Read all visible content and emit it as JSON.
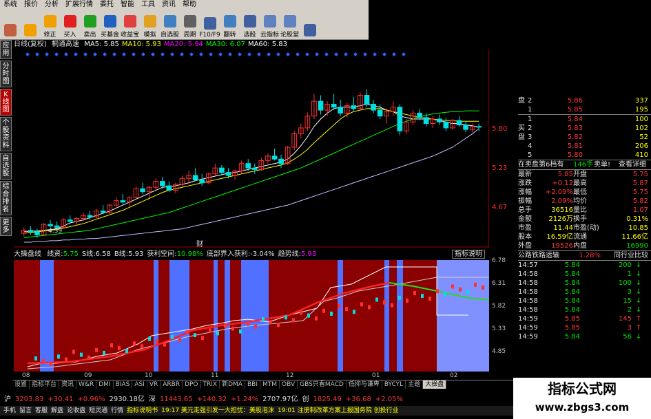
{
  "menu": [
    "系统",
    "报价",
    "分析",
    "扩展行情",
    "委托",
    "智能",
    "工具",
    "资讯",
    "帮助"
  ],
  "toolbar": [
    {
      "label": "",
      "icon": "grid-icon",
      "color": "#c06040"
    },
    {
      "label": "",
      "icon": "back-arrow-icon",
      "color": "#f0a000"
    },
    {
      "label": "修正",
      "icon": "up-down-arrow-icon",
      "color": "#f0a000"
    },
    {
      "label": "买入",
      "icon": "buy-icon",
      "color": "#e02020"
    },
    {
      "label": "卖出",
      "icon": "sell-icon",
      "color": "#20a020"
    },
    {
      "label": "买基金",
      "icon": "fund-icon",
      "color": "#2060c0"
    },
    {
      "label": "收益宝",
      "icon": "treasure-icon",
      "color": "#e04040"
    },
    {
      "label": "模拟",
      "icon": "simulate-icon",
      "color": "#e0a020"
    },
    {
      "label": "自选股",
      "icon": "star-list-icon",
      "color": "#4080c0"
    },
    {
      "label": "周期",
      "icon": "clock-icon",
      "color": "#606060"
    },
    {
      "label": "F10/F9",
      "icon": "f10-icon",
      "color": "#4060a0"
    },
    {
      "label": "翻转",
      "icon": "flip-icon",
      "color": "#4080c0"
    },
    {
      "label": "选股",
      "icon": "stock-pick-icon",
      "color": "#4060a0"
    },
    {
      "label": "云指标",
      "icon": "cloud-icon",
      "color": "#6080c0"
    },
    {
      "label": "论股堂",
      "icon": "forum-icon",
      "color": "#6080c0"
    },
    {
      "label": "",
      "icon": "info-icon",
      "color": "#4060a0"
    }
  ],
  "sidebar": [
    "应用",
    "分时图",
    "K线图",
    "个股资料",
    "自选股",
    "综合排名",
    "更多"
  ],
  "chart_main": {
    "title": "日线(复权)",
    "stock": "桐通高速",
    "ma": [
      {
        "name": "MA5",
        "value": "5.85",
        "color": "#ffffff"
      },
      {
        "name": "MA10",
        "value": "5.93",
        "color": "#ffff00"
      },
      {
        "name": "MA20",
        "value": "5.94",
        "color": "#ff00ff"
      },
      {
        "name": "MA30",
        "value": "6.07",
        "color": "#00ff00"
      },
      {
        "name": "MA60",
        "value": "5.83",
        "color": "#ffffff"
      }
    ],
    "ylabels": [
      "5.80",
      "5.23",
      "4.67"
    ],
    "annot": "4.39",
    "mark": "财"
  },
  "chart_data": {
    "type": "candlestick",
    "ylim": [
      4.3,
      6.6
    ],
    "candles": [
      [
        4.42,
        4.5,
        4.38,
        4.46
      ],
      [
        4.46,
        4.52,
        4.4,
        4.44
      ],
      [
        4.44,
        4.48,
        4.36,
        4.4
      ],
      [
        4.4,
        4.56,
        4.39,
        4.54
      ],
      [
        4.54,
        4.6,
        4.5,
        4.52
      ],
      [
        4.52,
        4.58,
        4.46,
        4.5
      ],
      [
        4.5,
        4.62,
        4.48,
        4.6
      ],
      [
        4.6,
        4.66,
        4.55,
        4.58
      ],
      [
        4.58,
        4.64,
        4.52,
        4.62
      ],
      [
        4.62,
        4.7,
        4.58,
        4.66
      ],
      [
        4.66,
        4.72,
        4.6,
        4.64
      ],
      [
        4.64,
        4.75,
        4.62,
        4.72
      ],
      [
        4.72,
        4.8,
        4.68,
        4.7
      ],
      [
        4.7,
        4.82,
        4.68,
        4.8
      ],
      [
        4.8,
        4.9,
        4.76,
        4.86
      ],
      [
        4.86,
        4.95,
        4.82,
        4.84
      ],
      [
        4.84,
        4.92,
        4.78,
        4.9
      ],
      [
        4.9,
        5.05,
        4.88,
        5.02
      ],
      [
        5.02,
        5.1,
        4.95,
        4.98
      ],
      [
        4.98,
        5.06,
        4.9,
        5.04
      ],
      [
        5.04,
        5.16,
        5.0,
        5.12
      ],
      [
        5.12,
        5.18,
        5.02,
        5.06
      ],
      [
        5.06,
        5.12,
        4.98,
        5.0
      ],
      [
        5.0,
        5.1,
        4.96,
        5.08
      ],
      [
        5.08,
        5.2,
        5.04,
        5.16
      ],
      [
        5.16,
        5.26,
        5.1,
        5.2
      ],
      [
        5.2,
        5.3,
        5.12,
        5.14
      ],
      [
        5.14,
        5.22,
        5.06,
        5.1
      ],
      [
        5.1,
        5.24,
        5.08,
        5.22
      ],
      [
        5.22,
        5.36,
        5.18,
        5.3
      ],
      [
        5.3,
        5.34,
        5.2,
        5.24
      ],
      [
        5.24,
        5.3,
        5.16,
        5.2
      ],
      [
        5.2,
        5.28,
        5.14,
        5.26
      ],
      [
        5.26,
        5.4,
        5.22,
        5.36
      ],
      [
        5.36,
        5.42,
        5.26,
        5.3
      ],
      [
        5.3,
        5.36,
        5.22,
        5.28
      ],
      [
        5.28,
        5.44,
        5.26,
        5.4
      ],
      [
        5.4,
        5.5,
        5.36,
        5.46
      ],
      [
        5.46,
        5.56,
        5.4,
        5.42
      ],
      [
        5.42,
        5.48,
        5.3,
        5.36
      ],
      [
        5.36,
        5.6,
        5.34,
        5.58
      ],
      [
        5.58,
        5.8,
        5.54,
        5.76
      ],
      [
        5.76,
        5.9,
        5.7,
        5.84
      ],
      [
        5.84,
        6.05,
        5.8,
        6.0
      ],
      [
        6.0,
        6.3,
        5.96,
        6.2
      ],
      [
        6.2,
        6.28,
        6.02,
        6.08
      ],
      [
        6.08,
        6.2,
        6.0,
        6.16
      ],
      [
        6.16,
        6.3,
        6.08,
        6.12
      ],
      [
        6.12,
        6.22,
        6.0,
        6.04
      ],
      [
        6.04,
        6.18,
        5.98,
        6.14
      ],
      [
        6.14,
        6.26,
        6.06,
        6.1
      ],
      [
        6.1,
        6.32,
        6.08,
        6.28
      ],
      [
        6.28,
        6.36,
        6.12,
        6.16
      ],
      [
        6.16,
        6.22,
        6.04,
        6.08
      ],
      [
        6.08,
        6.16,
        5.96,
        6.0
      ],
      [
        6.0,
        6.1,
        5.9,
        6.06
      ],
      [
        6.06,
        6.2,
        6.0,
        6.12
      ],
      [
        6.12,
        6.16,
        5.74,
        5.8
      ],
      [
        5.8,
        5.96,
        5.76,
        5.92
      ],
      [
        5.92,
        6.08,
        5.88,
        6.04
      ],
      [
        6.04,
        6.1,
        5.94,
        5.98
      ],
      [
        5.98,
        6.04,
        5.86,
        5.9
      ],
      [
        5.9,
        6.0,
        5.84,
        5.96
      ],
      [
        5.96,
        6.02,
        5.88,
        5.92
      ],
      [
        5.92,
        5.98,
        5.8,
        5.84
      ],
      [
        5.84,
        5.96,
        5.82,
        5.94
      ],
      [
        5.94,
        6.0,
        5.86,
        5.88
      ],
      [
        5.88,
        5.92,
        5.78,
        5.82
      ],
      [
        5.82,
        5.9,
        5.78,
        5.86
      ],
      [
        5.86,
        5.9,
        5.8,
        5.85
      ]
    ],
    "ma_lines": [
      {
        "name": "MA5",
        "color": "#ffffff",
        "values": [
          4.44,
          4.45,
          4.45,
          4.46,
          4.47,
          4.48,
          4.52,
          4.56,
          4.58,
          4.6,
          4.63,
          4.66,
          4.69,
          4.72,
          4.76,
          4.8,
          4.84,
          4.88,
          4.92,
          4.96,
          5.0,
          5.04,
          5.05,
          5.06,
          5.08,
          5.1,
          5.13,
          5.15,
          5.17,
          5.19,
          5.21,
          5.23,
          5.24,
          5.26,
          5.28,
          5.3,
          5.32,
          5.34,
          5.36,
          5.38,
          5.42,
          5.5,
          5.6,
          5.72,
          5.86,
          5.96,
          6.04,
          6.1,
          6.12,
          6.12,
          6.12,
          6.14,
          6.16,
          6.14,
          6.12,
          6.08,
          6.06,
          6.0,
          5.98,
          5.96,
          5.96,
          5.96,
          5.96,
          5.94,
          5.92,
          5.9,
          5.9,
          5.88,
          5.87,
          5.85
        ]
      },
      {
        "name": "MA10",
        "color": "#ffff00",
        "values": [
          4.42,
          4.43,
          4.44,
          4.45,
          4.46,
          4.47,
          4.49,
          4.51,
          4.53,
          4.55,
          4.58,
          4.61,
          4.64,
          4.67,
          4.7,
          4.73,
          4.77,
          4.81,
          4.85,
          4.89,
          4.93,
          4.97,
          5.0,
          5.02,
          5.04,
          5.06,
          5.08,
          5.1,
          5.12,
          5.14,
          5.16,
          5.18,
          5.2,
          5.22,
          5.24,
          5.26,
          5.28,
          5.3,
          5.32,
          5.34,
          5.37,
          5.42,
          5.48,
          5.55,
          5.64,
          5.72,
          5.8,
          5.88,
          5.96,
          6.02,
          6.06,
          6.08,
          6.1,
          6.1,
          6.1,
          6.08,
          6.06,
          6.04,
          6.02,
          6.0,
          5.98,
          5.97,
          5.96,
          5.95,
          5.94,
          5.94,
          5.93,
          5.93,
          5.93,
          5.93
        ]
      },
      {
        "name": "MA30",
        "color": "#00ff00",
        "values": [
          4.36,
          4.37,
          4.38,
          4.39,
          4.4,
          4.41,
          4.42,
          4.43,
          4.44,
          4.45,
          4.46,
          4.48,
          4.5,
          4.52,
          4.54,
          4.56,
          4.58,
          4.6,
          4.62,
          4.64,
          4.66,
          4.68,
          4.7,
          4.73,
          4.76,
          4.79,
          4.82,
          4.85,
          4.88,
          4.91,
          4.94,
          4.97,
          5.0,
          5.03,
          5.06,
          5.09,
          5.12,
          5.15,
          5.18,
          5.21,
          5.24,
          5.27,
          5.3,
          5.34,
          5.38,
          5.42,
          5.46,
          5.5,
          5.54,
          5.58,
          5.62,
          5.66,
          5.7,
          5.74,
          5.78,
          5.82,
          5.86,
          5.9,
          5.93,
          5.96,
          5.99,
          6.01,
          6.03,
          6.04,
          6.05,
          6.06,
          6.06,
          6.07,
          6.07,
          6.07
        ]
      },
      {
        "name": "MA60",
        "color": "#c0c0ff",
        "values": [
          4.3,
          4.3,
          4.31,
          4.31,
          4.32,
          4.32,
          4.33,
          4.33,
          4.34,
          4.34,
          4.35,
          4.35,
          4.36,
          4.37,
          4.38,
          4.39,
          4.4,
          4.41,
          4.42,
          4.43,
          4.44,
          4.45,
          4.46,
          4.47,
          4.48,
          4.5,
          4.52,
          4.54,
          4.56,
          4.58,
          4.6,
          4.62,
          4.64,
          4.66,
          4.68,
          4.7,
          4.72,
          4.74,
          4.76,
          4.78,
          4.8,
          4.83,
          4.86,
          4.89,
          4.92,
          4.95,
          4.98,
          5.01,
          5.04,
          5.07,
          5.1,
          5.13,
          5.16,
          5.19,
          5.22,
          5.25,
          5.28,
          5.31,
          5.34,
          5.37,
          5.4,
          5.43,
          5.46,
          5.5,
          5.54,
          5.58,
          5.64,
          5.7,
          5.76,
          5.83
        ]
      }
    ]
  },
  "chart_sub": {
    "title": "大操盘线",
    "items": [
      {
        "label": "线资:",
        "value": "5.75",
        "color": "#00e000"
      },
      {
        "label": "S线:",
        "value": "6.58",
        "color": "#e0e0e0"
      },
      {
        "label": "B线:",
        "value": "5.93",
        "color": "#e0e0e0"
      },
      {
        "label": "获利空间:",
        "value": "10.98%",
        "color": "#00e000"
      },
      {
        "label": "底部界入获利:",
        "value": "-3.04%",
        "color": "#e0e0e0"
      },
      {
        "label": "趋势线:",
        "value": "5.93",
        "color": "#ff00ff"
      }
    ],
    "right_labels": [
      "指标说明"
    ],
    "ylabels": [
      "6.78",
      "6.31",
      "5.82",
      "5.33",
      "4.85"
    ]
  },
  "xaxis": [
    "08",
    "09",
    "10",
    "11",
    "12",
    "01",
    "02"
  ],
  "tabs": [
    "设置",
    "指标平台",
    "资讯",
    "W&R",
    "DMI",
    "BIAS",
    "ASI",
    "VR",
    "ARBR",
    "DPO",
    "TRIX",
    "新DMA",
    "BBI",
    "MTM",
    "OBV",
    "GBS只看MACD",
    "低抑与谦卑",
    "BYCYL",
    "主题",
    "大操盘"
  ],
  "indexbar": [
    {
      "text": "沪",
      "color": "#e0e0e0"
    },
    {
      "text": "3203.83",
      "color": "#ff3838"
    },
    {
      "text": "+30.41",
      "color": "#ff3838"
    },
    {
      "text": "+0.96%",
      "color": "#ff3838"
    },
    {
      "text": "2930.18亿",
      "color": "#e0e0e0"
    },
    {
      "text": "深",
      "color": "#e0e0e0"
    },
    {
      "text": "11443.65",
      "color": "#ff3838"
    },
    {
      "text": "+140.32",
      "color": "#ff3838"
    },
    {
      "text": "+1.24%",
      "color": "#ff3838"
    },
    {
      "text": "2707.97亿",
      "color": "#e0e0e0"
    },
    {
      "text": "创",
      "color": "#e0e0e0"
    },
    {
      "text": "1825.49",
      "color": "#ff3838"
    },
    {
      "text": "+36.68",
      "color": "#ff3838"
    },
    {
      "text": "+2.05%",
      "color": "#ff3838"
    }
  ],
  "statusbar": [
    "手机",
    "留言",
    "客服",
    "解盘",
    "论收盘",
    "短灵通",
    "行情",
    "指标说明书",
    "19:17 美元走强引发一大担忧：美股泡沫",
    "19:01 注册制改革方案上报国务院 创投行业"
  ],
  "order_book": {
    "sell": [
      {
        "lvl": "2",
        "price": "5.86",
        "vol": "337"
      },
      {
        "lvl": "1",
        "price": "5.85",
        "vol": "195"
      }
    ],
    "buy": [
      {
        "lvl": "1",
        "price": "5.84",
        "vol": "100"
      },
      {
        "lvl": "2",
        "price": "5.83",
        "vol": "102"
      },
      {
        "lvl": "3",
        "price": "5.82",
        "vol": "52"
      },
      {
        "lvl": "4",
        "price": "5.81",
        "vol": "206"
      },
      {
        "lvl": "5",
        "price": "5.80",
        "vol": "410"
      }
    ],
    "sell_label": "盘",
    "buy_label": "买盘",
    "pending": "在卖盘第6档有",
    "pending_vol": "146手",
    "sell_btn": "卖单!",
    "detail_btn": "查看详细"
  },
  "quote": [
    {
      "k1": "最新",
      "v1": "5.85",
      "c1": "red",
      "k2": "开盘",
      "v2": "5.75",
      "c2": "red"
    },
    {
      "k1": "涨跌",
      "v1": "+0.12",
      "c1": "red",
      "k2": "最高",
      "v2": "5.87",
      "c2": "red"
    },
    {
      "k1": "涨幅",
      "v1": "+2.09%",
      "c1": "red",
      "k2": "最低",
      "v2": "5.75",
      "c2": "red"
    },
    {
      "k1": "振幅",
      "v1": "2.09%",
      "c1": "red",
      "k2": "均价",
      "v2": "5.82",
      "c2": "red"
    },
    {
      "k1": "总手",
      "v1": "36516",
      "c1": "yel",
      "k2": "量比",
      "v2": "1.07",
      "c2": "red"
    },
    {
      "k1": "金额",
      "v1": "2126万",
      "c1": "yel",
      "k2": "换手",
      "v2": "0.31%",
      "c2": "yel"
    },
    {
      "k1": "市盈",
      "v1": "11.44",
      "c1": "yel",
      "k2": "市盈(动)",
      "v2": "10.85",
      "c2": "yel"
    },
    {
      "k1": "股本",
      "v1": "16.59亿",
      "c1": "yel",
      "k2": "流通",
      "v2": "11.66亿",
      "c2": "yel"
    },
    {
      "k1": "外盘",
      "v1": "19526",
      "c1": "red",
      "k2": "内盘",
      "v2": "16990",
      "c2": "green"
    }
  ],
  "sector": {
    "name": "公路铁路运输",
    "pct": "1.28%",
    "btn": "同行业比较"
  },
  "ticks": [
    {
      "t": "14:57",
      "p": "5.84",
      "v": "200",
      "dir": "down"
    },
    {
      "t": "14:58",
      "p": "5.84",
      "v": "1",
      "dir": "down"
    },
    {
      "t": "14:58",
      "p": "5.84",
      "v": "100",
      "dir": "down"
    },
    {
      "t": "14:58",
      "p": "5.84",
      "v": "3",
      "dir": "down"
    },
    {
      "t": "14:58",
      "p": "5.84",
      "v": "15",
      "dir": "down"
    },
    {
      "t": "14:58",
      "p": "5.84",
      "v": "2",
      "dir": "down"
    },
    {
      "t": "14:59",
      "p": "5.85",
      "v": "145",
      "dir": "up"
    },
    {
      "t": "14:59",
      "p": "5.85",
      "v": "3",
      "dir": "up"
    },
    {
      "t": "14:59",
      "p": "5.84",
      "v": "56",
      "dir": "down"
    }
  ],
  "watermark": {
    "line1": "指标公式网",
    "line2": "www.zbgs3.com"
  }
}
